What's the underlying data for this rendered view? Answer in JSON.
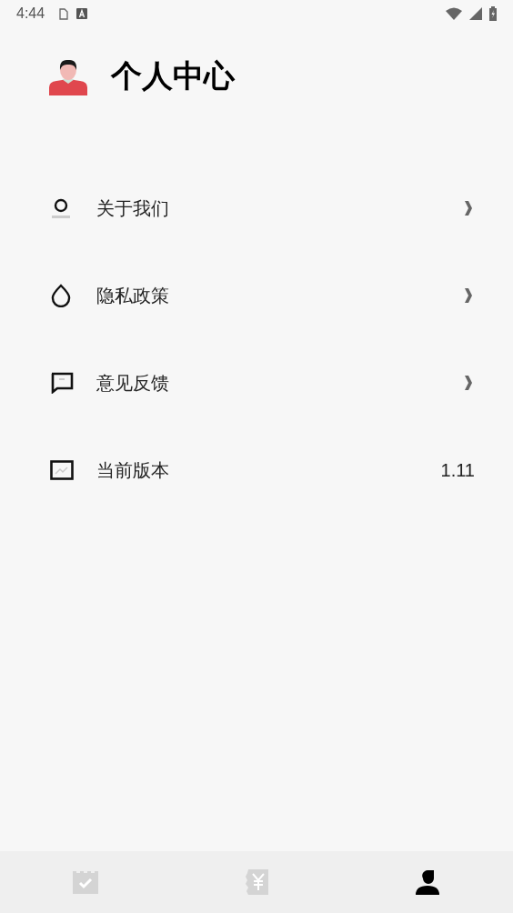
{
  "status_bar": {
    "time": "4:44"
  },
  "header": {
    "title": "个人中心"
  },
  "menu": [
    {
      "kind": "link",
      "label": "关于我们"
    },
    {
      "kind": "link",
      "label": "隐私政策"
    },
    {
      "kind": "link",
      "label": "意见反馈"
    },
    {
      "kind": "value",
      "label": "当前版本",
      "value": "1.11"
    }
  ],
  "tabs": [
    {
      "selected": false
    },
    {
      "selected": false
    },
    {
      "selected": true
    }
  ]
}
